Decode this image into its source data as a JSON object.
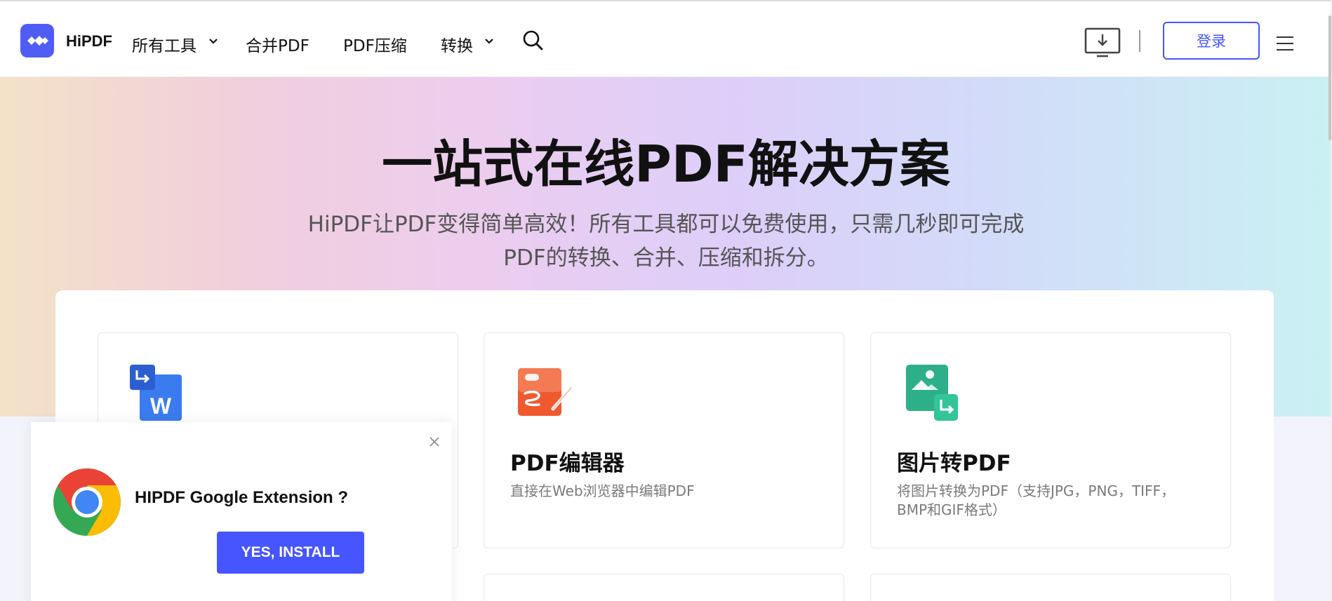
{
  "header": {
    "brand": "HiPDF",
    "nav": {
      "all_tools": "所有工具",
      "merge_pdf": "合并PDF",
      "compress_pdf": "PDF压缩",
      "convert": "转换"
    },
    "login": "登录"
  },
  "hero": {
    "title": "一站式在线PDF解决方案",
    "subtitle_line1": "HiPDF让PDF变得简单高效！所有工具都可以免费使用，只需几秒即可完成",
    "subtitle_line2": "PDF的转换、合并、压缩和拆分。"
  },
  "tools": [
    {
      "title": "",
      "desc": "",
      "icon": "pdf-to-word-icon"
    },
    {
      "title": "PDF编辑器",
      "desc": "直接在Web浏览器中编辑PDF",
      "icon": "pdf-editor-icon"
    },
    {
      "title": "图片转PDF",
      "desc_line1": "将图片转换为PDF（支持JPG，PNG，TIFF，",
      "desc_line2": "BMP和GIF格式）",
      "icon": "image-to-pdf-icon"
    }
  ],
  "popup": {
    "text": "HIPDF Google Extension ?",
    "button": "YES, INSTALL",
    "icon": "chrome-icon"
  },
  "colors": {
    "accent": "#4655ff",
    "logo": "#4f5df5",
    "word_blue": "#2f6fe6",
    "editor_orange": "#f0592e",
    "image_green": "#2db08a"
  }
}
